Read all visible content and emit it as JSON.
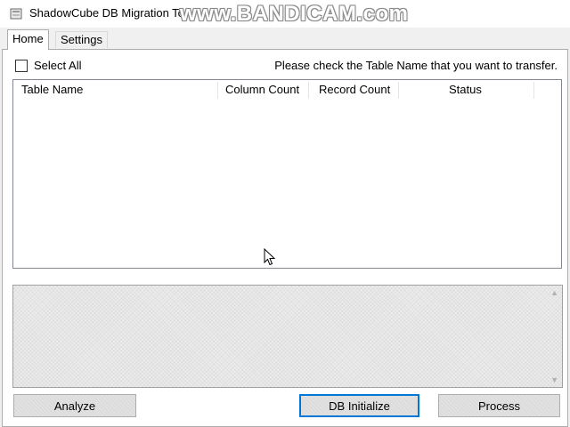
{
  "window": {
    "title": "ShadowCube DB Migration Tool",
    "title_visible": "ShadowCube DB Migration To",
    "watermark": "www.BANDICAM.com"
  },
  "tabs": [
    {
      "label": "Home",
      "selected": true
    },
    {
      "label": "Settings",
      "selected": false
    }
  ],
  "home": {
    "select_all_label": "Select All",
    "select_all_checked": false,
    "instruction": "Please check the Table Name that you want to transfer."
  },
  "table": {
    "columns": [
      "Table Name",
      "Column Count",
      "Record Count",
      "Status"
    ],
    "rows": []
  },
  "buttons": {
    "analyze": "Analyze",
    "db_initialize": "DB Initialize",
    "process": "Process"
  },
  "colors": {
    "focus_border": "#0078d7",
    "panel_background": "#ffffff",
    "window_background": "#f0f0f0"
  }
}
